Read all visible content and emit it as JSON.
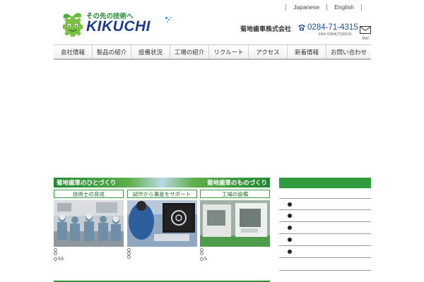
{
  "header": {
    "languages": [
      "Japanese",
      "English"
    ],
    "tagline": "その先の技術へ",
    "brand": "KIKUCHI",
    "company_name": "菊地歯車株式会社",
    "phone": "0284-71-4315",
    "fax": "FAX 0284(72)6519",
    "mail_label": "Mail"
  },
  "nav": {
    "items": [
      "会社情報",
      "製品の紹介",
      "設備状況",
      "工場の紹介",
      "リクルート",
      "アクセス",
      "新着情報",
      "お問い合わせ"
    ]
  },
  "main": {
    "banner_left": "菊地歯車のひとづくり",
    "banner_right": "菊地歯車のものづくり",
    "cards": [
      {
        "label": "技術士の育成",
        "links": [
          "",
          "",
          "SS"
        ]
      },
      {
        "label": "試作から量産をサポート",
        "links": [
          "",
          "",
          ""
        ]
      },
      {
        "label": "工場の設備",
        "links": [
          "",
          "",
          "5"
        ]
      }
    ]
  },
  "colors": {
    "brand_green": "#2f9a3e",
    "brand_blue": "#1d3a8f",
    "phone_blue": "#1d4f9c"
  }
}
